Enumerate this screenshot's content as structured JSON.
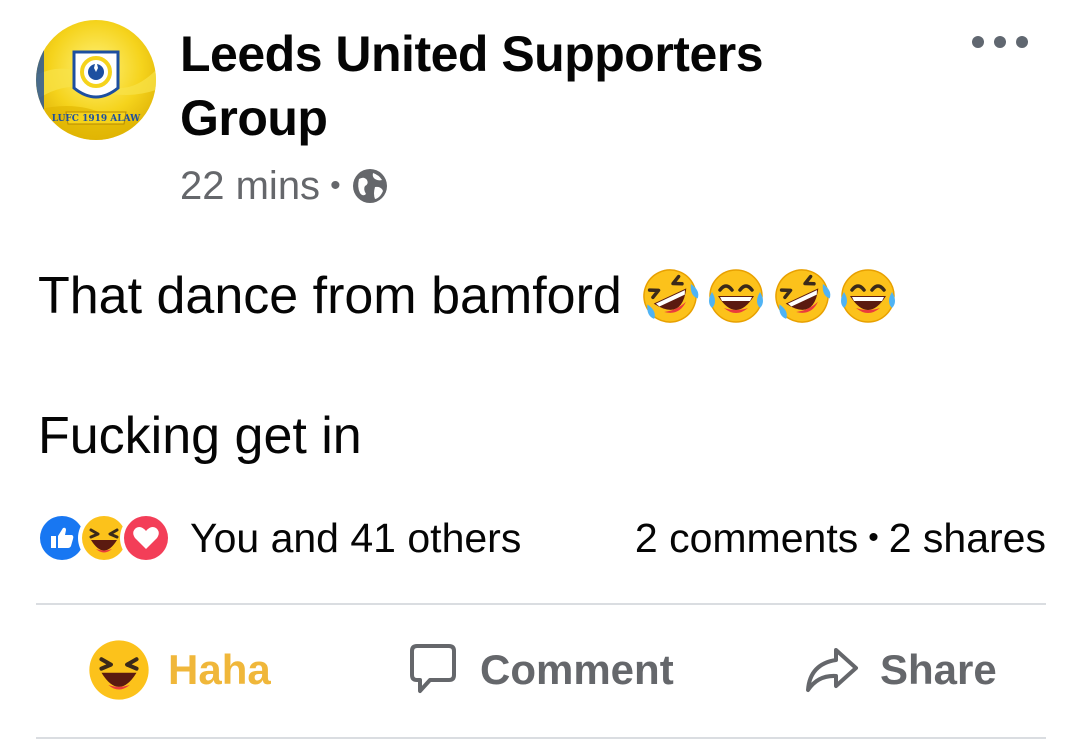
{
  "header": {
    "group_name": "Leeds United Supporters Group",
    "avatar_text": "LUFC 1919 ALAW",
    "timestamp": "22 mins",
    "separator": "•",
    "privacy_icon": "globe-icon"
  },
  "post": {
    "line1": "That dance from bamford",
    "line1_emojis": [
      "rolling-on-floor-laughing-icon",
      "tears-of-joy-icon",
      "rolling-on-floor-laughing-icon",
      "tears-of-joy-icon"
    ],
    "line2": "Fucking get in"
  },
  "summary": {
    "reactions": [
      "like-icon",
      "haha-icon",
      "love-icon"
    ],
    "reactors": "You and 41 others",
    "comments": "2 comments",
    "separator": "•",
    "shares": "2 shares"
  },
  "actions": {
    "haha_label": "Haha",
    "comment_label": "Comment",
    "share_label": "Share"
  },
  "colors": {
    "haha_active": "#f0b73a",
    "secondary_text": "#65676b",
    "like_blue": "#1877f2",
    "love_red": "#f33e58",
    "avatar_yellow": "#f5d31c"
  }
}
